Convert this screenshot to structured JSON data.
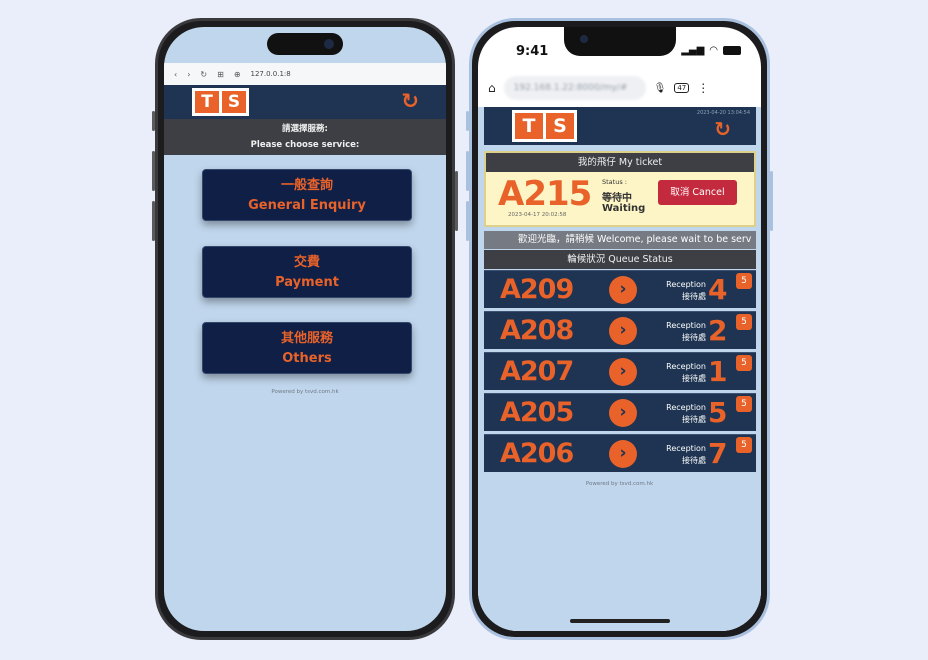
{
  "left_phone": {
    "browser": {
      "back_icon": "‹",
      "forward_icon": "›",
      "reload_icon": "↻",
      "apps_icon": "⊞",
      "globe_icon": "⊕",
      "url": "127.0.0.1:8"
    },
    "header": {
      "logo_left": "T",
      "logo_right": "S",
      "refresh_icon": "↻"
    },
    "prompt_zh": "請選擇服務:",
    "prompt_en": "Please choose service:",
    "services": [
      {
        "zh": "一般查詢",
        "en": "General Enquiry"
      },
      {
        "zh": "交費",
        "en": "Payment"
      },
      {
        "zh": "其他服務",
        "en": "Others"
      }
    ],
    "powered_by": "Powered by tsvd.com.hk"
  },
  "right_phone": {
    "status_bar": {
      "time": "9:41",
      "signal": "▂▄▆",
      "wifi": "◠"
    },
    "chrome": {
      "home_icon": "⌂",
      "url_blurred": "192.168.1.22:8000/my/#",
      "mic_icon": "🎙",
      "tab_count": "47",
      "menu_icon": "⋮"
    },
    "header": {
      "logo_left": "T",
      "logo_right": "S",
      "timestamp": "2023-04-20 13:04:54",
      "refresh_icon": "↻"
    },
    "ticket": {
      "title": "我的飛仔 My ticket",
      "number": "A215",
      "issued": "2023-04-17 20:02:58",
      "status_label": "Status :",
      "status_zh": "等待中",
      "status_en": "Waiting",
      "cancel_label": "取消 Cancel"
    },
    "welcome": "歡迎光臨，請稍候 Welcome, please wait to be serv",
    "queue_title": "輪候狀況 Queue Status",
    "queue": [
      {
        "number": "A209",
        "rec_en": "Reception",
        "rec_zh": "接待處",
        "counter": "4",
        "badge": "5"
      },
      {
        "number": "A208",
        "rec_en": "Reception",
        "rec_zh": "接待處",
        "counter": "2",
        "badge": "5"
      },
      {
        "number": "A207",
        "rec_en": "Reception",
        "rec_zh": "接待處",
        "counter": "1",
        "badge": "5"
      },
      {
        "number": "A205",
        "rec_en": "Reception",
        "rec_zh": "接待處",
        "counter": "5",
        "badge": "5"
      },
      {
        "number": "A206",
        "rec_en": "Reception",
        "rec_zh": "接待處",
        "counter": "7",
        "badge": "5"
      }
    ],
    "arrow_icon": "›",
    "powered_by": "Powered by tsvd.com.hk"
  },
  "colors": {
    "accent": "#e8622a",
    "header_navy": "#1e3452",
    "button_navy": "#0f1f46",
    "app_bg": "#c0d6ec",
    "cancel_red": "#c42a3e",
    "ticket_yellow": "#fdf5c6"
  }
}
